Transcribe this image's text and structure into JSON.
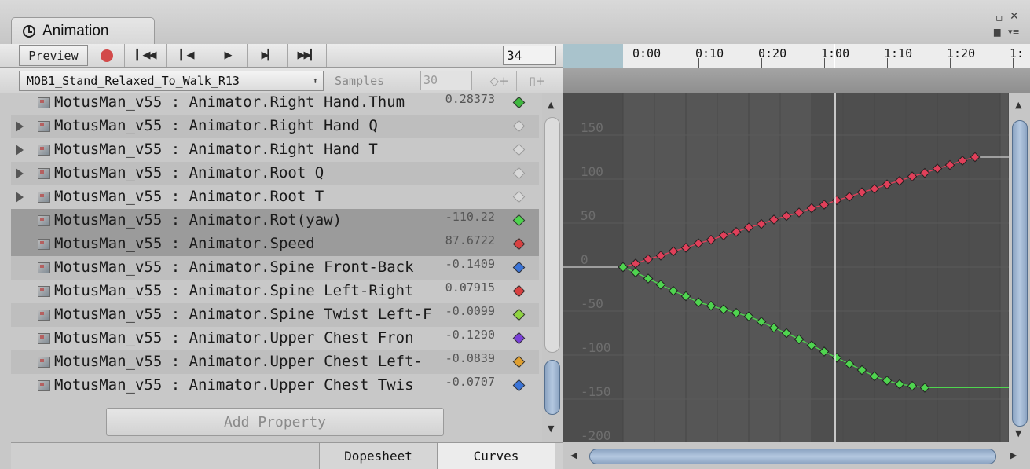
{
  "window": {
    "tab_title": "Animation",
    "controls": {
      "maximize": "▫",
      "close": "✕",
      "lock": "🔒",
      "menu": "▾≡"
    }
  },
  "toolbar": {
    "preview_label": "Preview",
    "frame_value": "34"
  },
  "clip": {
    "name": "MOB1_Stand_Relaxed_To_Walk_R13",
    "dropdown_arrow": "⬍",
    "samples_label": "Samples",
    "samples_value": "30",
    "add_key_label": "◇+",
    "add_event_label": "▯+"
  },
  "properties": [
    {
      "name": "MotusMan_v55 : Animator.Right Hand.Thum",
      "value": "0.28373",
      "key_color": "#3fb83f",
      "expandable": false,
      "selected": false
    },
    {
      "name": "MotusMan_v55 : Animator.Right Hand Q",
      "value": "",
      "key_color": "",
      "expandable": true,
      "selected": false
    },
    {
      "name": "MotusMan_v55 : Animator.Right Hand T",
      "value": "",
      "key_color": "",
      "expandable": true,
      "selected": false
    },
    {
      "name": "MotusMan_v55 : Animator.Root Q",
      "value": "",
      "key_color": "",
      "expandable": true,
      "selected": false
    },
    {
      "name": "MotusMan_v55 : Animator.Root T",
      "value": "",
      "key_color": "",
      "expandable": true,
      "selected": false
    },
    {
      "name": "MotusMan_v55 : Animator.Rot(yaw)",
      "value": "-110.22",
      "key_color": "#4fd44f",
      "expandable": false,
      "selected": true
    },
    {
      "name": "MotusMan_v55 : Animator.Speed",
      "value": "87.6722",
      "key_color": "#d84040",
      "expandable": false,
      "selected": true
    },
    {
      "name": "MotusMan_v55 : Animator.Spine Front-Back",
      "value": "-0.1409",
      "key_color": "#3a74d8",
      "expandable": false,
      "selected": false
    },
    {
      "name": "MotusMan_v55 : Animator.Spine Left-Right",
      "value": "0.07915",
      "key_color": "#d84040",
      "expandable": false,
      "selected": false
    },
    {
      "name": "MotusMan_v55 : Animator.Spine Twist Left-F",
      "value": "-0.0099",
      "key_color": "#8fd440",
      "expandable": false,
      "selected": false
    },
    {
      "name": "MotusMan_v55 : Animator.Upper Chest Fron",
      "value": "-0.1290",
      "key_color": "#7a40d8",
      "expandable": false,
      "selected": false
    },
    {
      "name": "MotusMan_v55 : Animator.Upper Chest Left-",
      "value": "-0.0839",
      "key_color": "#e0a030",
      "expandable": false,
      "selected": false
    },
    {
      "name": "MotusMan_v55 : Animator.Upper Chest Twis",
      "value": "-0.0707",
      "key_color": "#3a74d8",
      "expandable": false,
      "selected": false
    }
  ],
  "add_property_label": "Add Property",
  "bottom_tabs": {
    "dopesheet": "Dopesheet",
    "curves": "Curves"
  },
  "timeline": {
    "ticks": [
      "0:00",
      "0:10",
      "0:20",
      "1:00",
      "1:10",
      "1:20",
      "1:"
    ],
    "current_frame_label": "1:00"
  },
  "curve_editor": {
    "y_labels": [
      "150",
      "100",
      "50",
      "0",
      "-50",
      "-100",
      "-150",
      "-200"
    ],
    "curves": [
      {
        "name": "Speed",
        "color": "#e0405a",
        "line_color": "#d0d0d0",
        "keys_y": [
          0,
          4,
          9,
          13,
          18,
          22,
          27,
          31,
          36,
          40,
          45,
          49,
          54,
          58,
          62,
          67,
          71,
          76,
          80,
          85,
          89,
          94,
          98,
          103,
          107,
          112,
          116,
          121,
          125
        ]
      },
      {
        "name": "Rot(yaw)",
        "color": "#4fd44f",
        "line_color": "#4fd44f",
        "keys_y": [
          0,
          -6,
          -13,
          -20,
          -27,
          -33,
          -40,
          -44,
          -48,
          -52,
          -56,
          -62,
          -69,
          -75,
          -82,
          -89,
          -96,
          -103,
          -110,
          -117,
          -124,
          -129,
          -133,
          -135,
          -137
        ]
      }
    ]
  }
}
